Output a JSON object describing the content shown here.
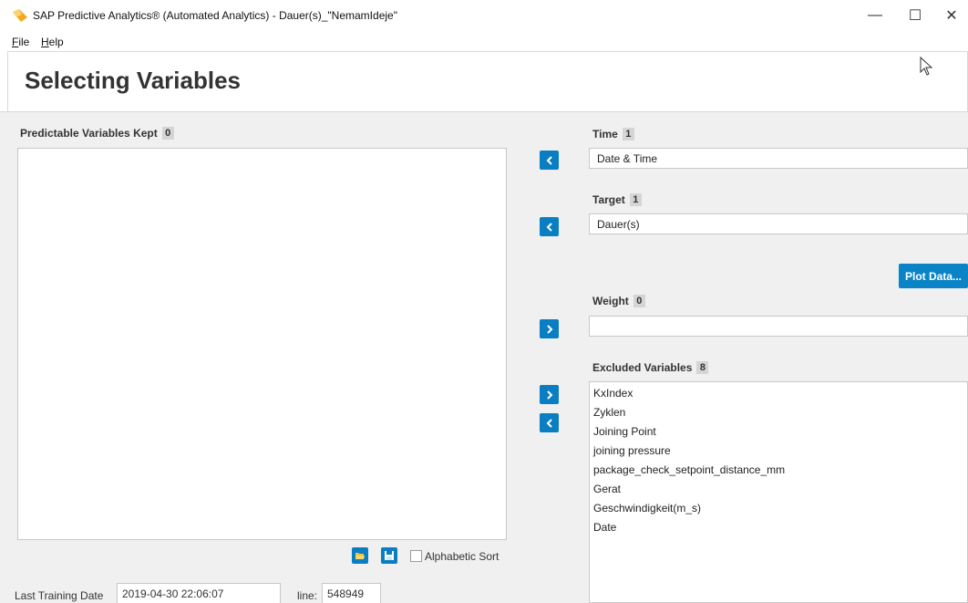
{
  "window": {
    "title": "SAP Predictive Analytics® (Automated Analytics) - Dauer(s)_\"NemamIdeje\"",
    "minimize": "—",
    "maximize": "☐",
    "close": "✕"
  },
  "menu": [
    {
      "mnemonic": "F",
      "rest": "ile"
    },
    {
      "mnemonic": "H",
      "rest": "elp"
    }
  ],
  "page": {
    "title": "Selecting Variables"
  },
  "predictable": {
    "label": "Predictable Variables Kept",
    "count": "0",
    "items": []
  },
  "time": {
    "label": "Time",
    "count": "1",
    "value": "Date & Time"
  },
  "target": {
    "label": "Target",
    "count": "1",
    "value": "Dauer(s)"
  },
  "plot_button": "Plot Data...",
  "weight": {
    "label": "Weight",
    "count": "0",
    "value": ""
  },
  "excluded": {
    "label": "Excluded Variables",
    "count": "8",
    "items": [
      "KxIndex",
      "Zyklen",
      "Joining Point",
      "joining pressure",
      "package_check_setpoint_distance_mm",
      "Gerat",
      "Geschwindigkeit(m_s)",
      "Date"
    ]
  },
  "sort": {
    "label": "Alphabetic Sort",
    "checked": false
  },
  "status": {
    "last_training_label": "Last Training Date",
    "last_training_value": "2019-04-30 22:06:07",
    "line_label": "line:",
    "line_value": "548949"
  },
  "colors": {
    "accent": "#0a7ec2",
    "panel_bg": "#f0f0f0",
    "logo_orange": "#f5a623"
  },
  "icons": {
    "move_left": "chevron-left-icon",
    "move_right": "chevron-right-icon",
    "open": "folder-open-icon",
    "save": "save-icon"
  }
}
